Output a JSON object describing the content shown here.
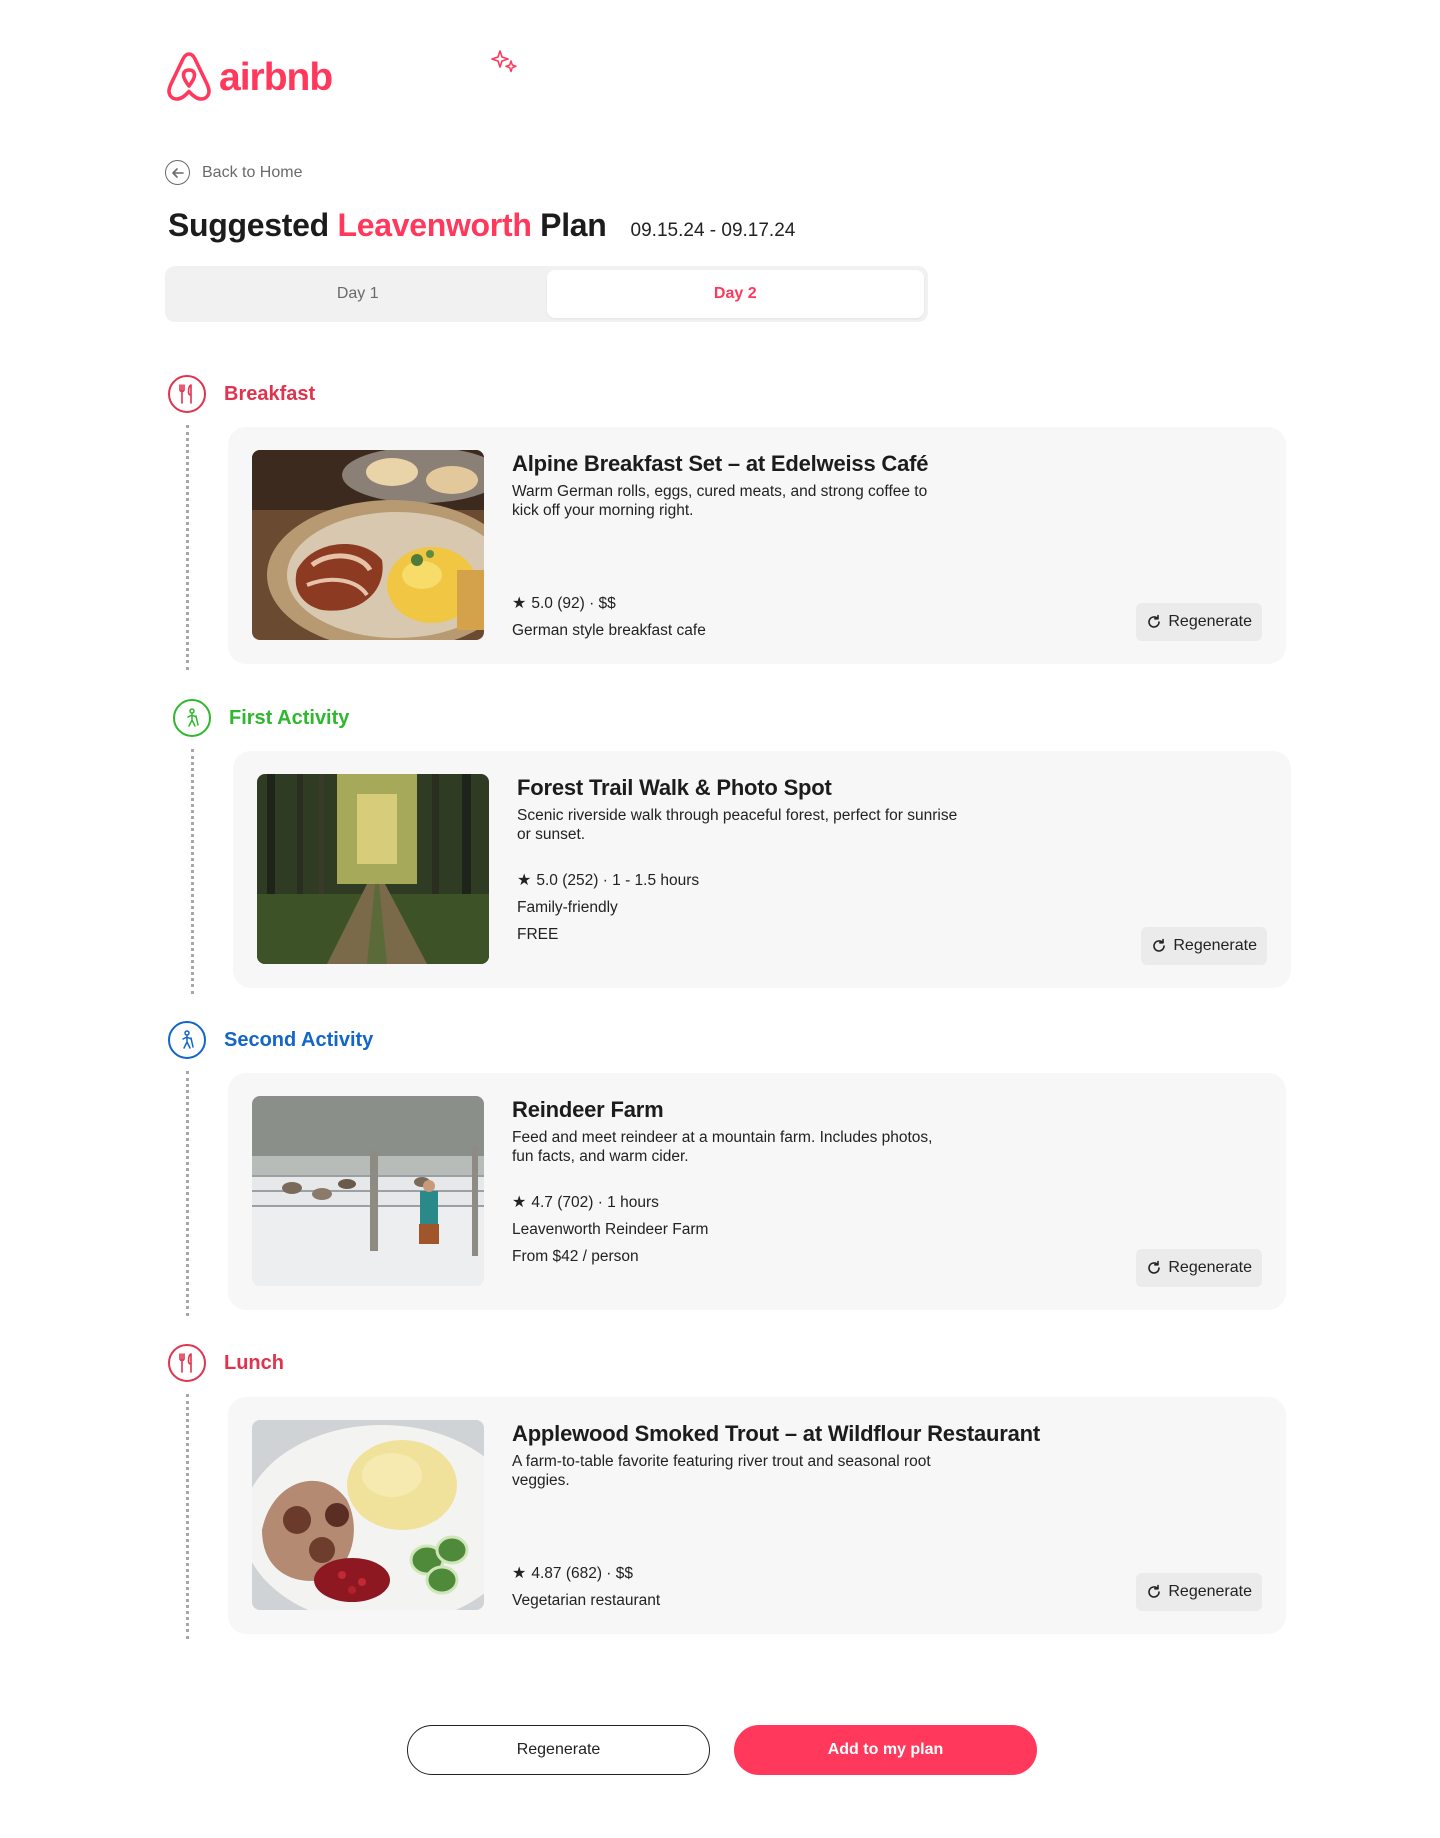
{
  "brand": {
    "name": "airbnb",
    "accent": "#FF385C"
  },
  "nav": {
    "back_label": "Back to Home"
  },
  "header": {
    "title_prefix": "Suggested ",
    "title_city": "Leavenworth",
    "title_suffix": " Plan",
    "dates": "09.15.24 - 09.17.24"
  },
  "tabs": [
    {
      "label": "Day 1",
      "active": false
    },
    {
      "label": "Day 2",
      "active": true
    }
  ],
  "sections": [
    {
      "label": "Breakfast",
      "color": "#E0334E",
      "icon": "utensils-icon",
      "item": {
        "name": "Alpine Breakfast Set – at Edelweiss Café",
        "description": "Warm German rolls, eggs, cured meats, and strong coffee to kick off your morning right.",
        "rating": "5.0 (92) · $$",
        "details": [
          "German style breakfast cafe"
        ],
        "photo": "breakfast-plate-image"
      }
    },
    {
      "label": "First Activity",
      "color": "#2EB82E",
      "icon": "hiker-icon",
      "item": {
        "name": "Forest Trail Walk & Photo Spot",
        "description": "Scenic riverside walk through peaceful forest, perfect for sunrise or sunset.",
        "rating": "5.0 (252) · 1 - 1.5 hours",
        "details": [
          "Family-friendly",
          "FREE"
        ],
        "photo": "forest-trail-image"
      }
    },
    {
      "label": "Second Activity",
      "color": "#1266C8",
      "icon": "hiker-icon",
      "item": {
        "name": "Reindeer Farm",
        "description": "Feed and meet reindeer at a mountain farm. Includes photos, fun facts, and warm cider.",
        "rating": "4.7 (702) · 1 hours",
        "details": [
          "Leavenworth Reindeer Farm",
          "From $42 / person"
        ],
        "photo": "reindeer-farm-image"
      }
    },
    {
      "label": "Lunch",
      "color": "#E0334E",
      "icon": "utensils-icon",
      "item": {
        "name": "Applewood Smoked Trout – at Wildflour Restaurant",
        "description": "A farm-to-table favorite featuring river trout and seasonal root veggies.",
        "rating": "4.87 (682) · $$",
        "details": [
          "Vegetarian restaurant"
        ],
        "photo": "lunch-plate-image"
      }
    }
  ],
  "card_regenerate_label": "Regenerate",
  "footer": {
    "regenerate_label": "Regenerate",
    "add_label": "Add to my plan"
  }
}
